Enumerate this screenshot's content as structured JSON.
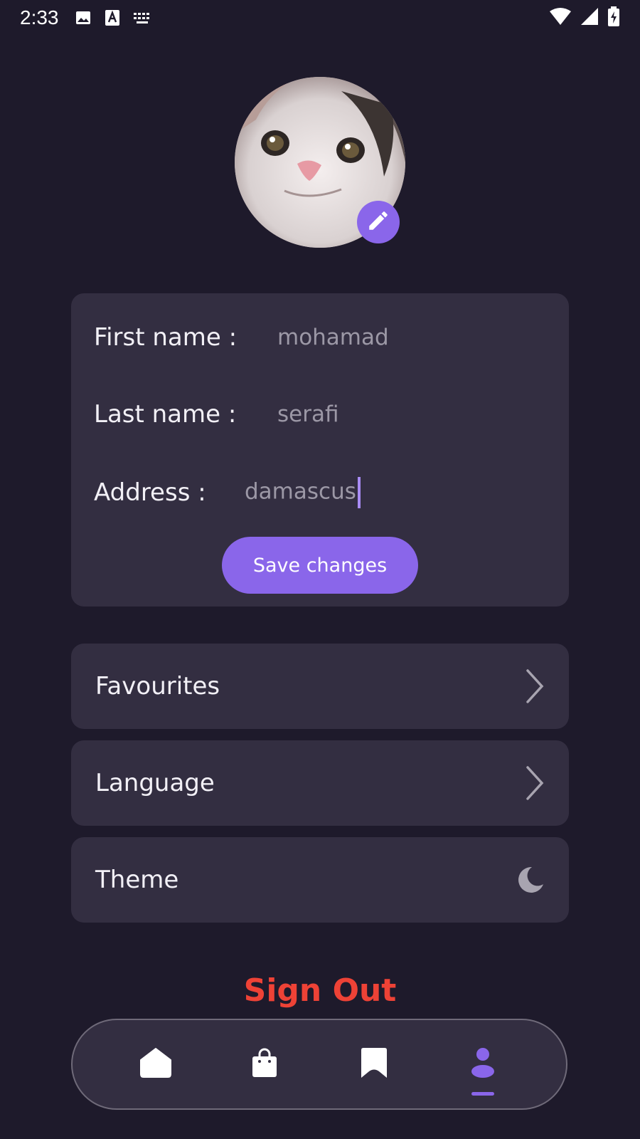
{
  "status_bar": {
    "time": "2:33",
    "icons": [
      "image-icon",
      "text-a-icon",
      "keyboard-icon",
      "wifi-icon",
      "signal-icon",
      "battery-charging-icon"
    ]
  },
  "profile": {
    "avatar_desc": "cat-avatar",
    "edit_icon": "pencil-icon"
  },
  "form": {
    "first_name_label": "First name :",
    "first_name_value": "mohamad",
    "last_name_label": "Last name :",
    "last_name_value": "serafi",
    "address_label": "Address :",
    "address_value": "damascus",
    "save_label": "Save changes"
  },
  "menu": {
    "favourites": "Favourites",
    "language": "Language",
    "theme": "Theme"
  },
  "sign_out": "Sign Out",
  "bottom_nav": {
    "items": [
      "home-icon",
      "bag-icon",
      "bookmark-icon",
      "profile-icon"
    ],
    "active": "profile-icon"
  },
  "colors": {
    "background": "#1e1a2b",
    "card": "#332e41",
    "accent": "#8a66ea",
    "danger": "#ee4236"
  }
}
